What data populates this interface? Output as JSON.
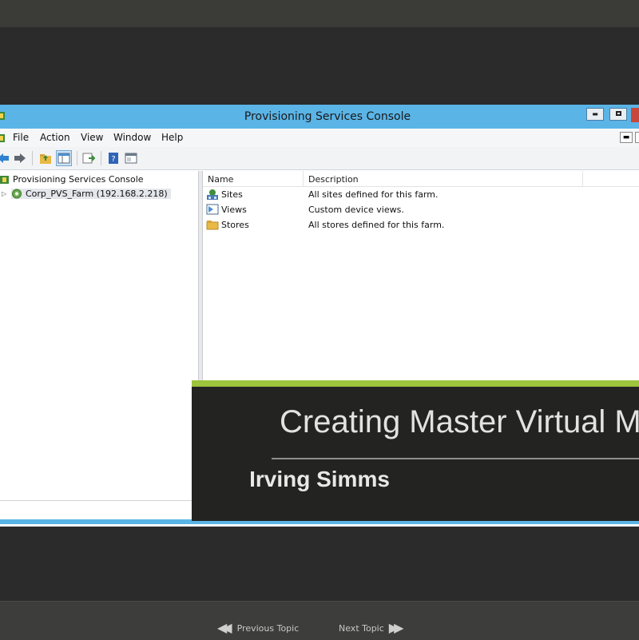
{
  "window": {
    "title": "Provisioning Services Console",
    "minimize_glyph": "▬",
    "restore_glyph": "▫",
    "mdi_minimize_glyph": "▬"
  },
  "menu": {
    "items": [
      "File",
      "Action",
      "View",
      "Window",
      "Help"
    ]
  },
  "toolbar": {
    "icons": [
      "back-arrow-icon",
      "forward-arrow-icon",
      "up-folder-icon",
      "show-hide-tree-icon",
      "export-list-icon",
      "help-icon",
      "properties-icon"
    ]
  },
  "tree": {
    "root_label": "Provisioning Services Console",
    "farm_label": "Corp_PVS_Farm (192.168.2.218)"
  },
  "list": {
    "columns": [
      "Name",
      "Description"
    ],
    "rows": [
      {
        "name": "Sites",
        "description": "All sites defined for this farm.",
        "icon": "sites-icon"
      },
      {
        "name": "Views",
        "description": "Custom device views.",
        "icon": "views-icon"
      },
      {
        "name": "Stores",
        "description": "All stores defined for this farm.",
        "icon": "stores-icon"
      }
    ]
  },
  "overlay": {
    "title": "Creating Master Virtual Ma",
    "author": "Irving Simms",
    "accent_color": "#9ec33d"
  },
  "player": {
    "previous_label": "Previous Topic",
    "next_label": "Next Topic"
  },
  "colors": {
    "titlebar": "#5ab4e6",
    "close_button": "#c9463b"
  }
}
